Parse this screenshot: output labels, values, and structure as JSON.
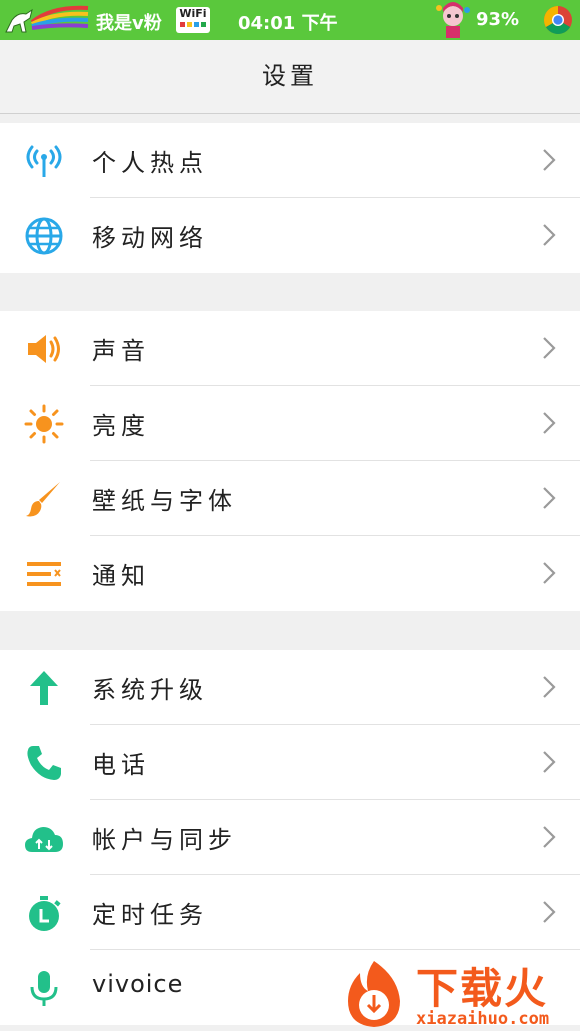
{
  "status_bar": {
    "carrier": "我是v粉",
    "wifi_badge": "WiFi",
    "time": "04:01 下午",
    "battery": "93%"
  },
  "header": {
    "title": "设置"
  },
  "groups": [
    {
      "items": [
        {
          "label": "个人热点",
          "icon": "hotspot-icon",
          "color": "#29a8e8"
        },
        {
          "label": "移动网络",
          "icon": "globe-icon",
          "color": "#29a8e8"
        }
      ]
    },
    {
      "items": [
        {
          "label": "声音",
          "icon": "speaker-icon",
          "color": "#f7931e"
        },
        {
          "label": "亮度",
          "icon": "sun-icon",
          "color": "#f7931e"
        },
        {
          "label": "壁纸与字体",
          "icon": "paintbrush-icon",
          "color": "#f7931e"
        },
        {
          "label": "通知",
          "icon": "notification-list-icon",
          "color": "#f7931e"
        }
      ]
    },
    {
      "items": [
        {
          "label": "系统升级",
          "icon": "arrow-up-icon",
          "color": "#22c08a"
        },
        {
          "label": "电话",
          "icon": "phone-icon",
          "color": "#22c08a"
        },
        {
          "label": "帐户与同步",
          "icon": "cloud-sync-icon",
          "color": "#22c08a"
        },
        {
          "label": "定时任务",
          "icon": "stopwatch-icon",
          "color": "#22c08a"
        },
        {
          "label": "vivoice",
          "icon": "microphone-icon",
          "color": "#22c08a"
        }
      ]
    }
  ],
  "watermark": {
    "brand": "下载火",
    "url": "xiazaihuo.com"
  }
}
